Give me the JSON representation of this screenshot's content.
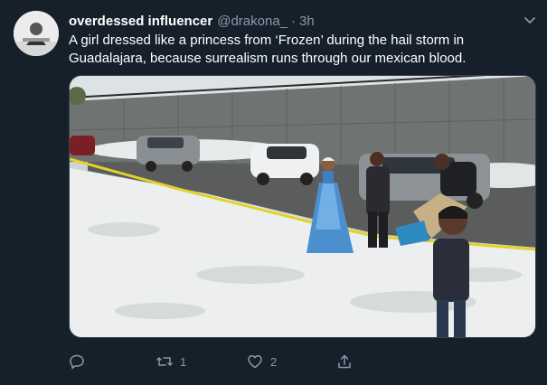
{
  "tweet": {
    "display_name": "overdessed influencer",
    "handle": "@drakona_",
    "separator": "·",
    "time": "3h",
    "text": "A girl dressed like a princess from ‘Frozen’ during the hail storm in Guadalajara, because surrealism runs through our mexican blood."
  },
  "actions": {
    "reply_count": "",
    "retweet_count": "1",
    "like_count": "2"
  },
  "icons": {
    "avatar": "avatar-image",
    "menu": "chevron-down-icon",
    "reply": "reply-icon",
    "retweet": "retweet-icon",
    "like": "heart-icon",
    "share": "share-icon"
  },
  "colors": {
    "background": "#15202b",
    "secondary_text": "#8899a6",
    "border": "#38444d"
  }
}
